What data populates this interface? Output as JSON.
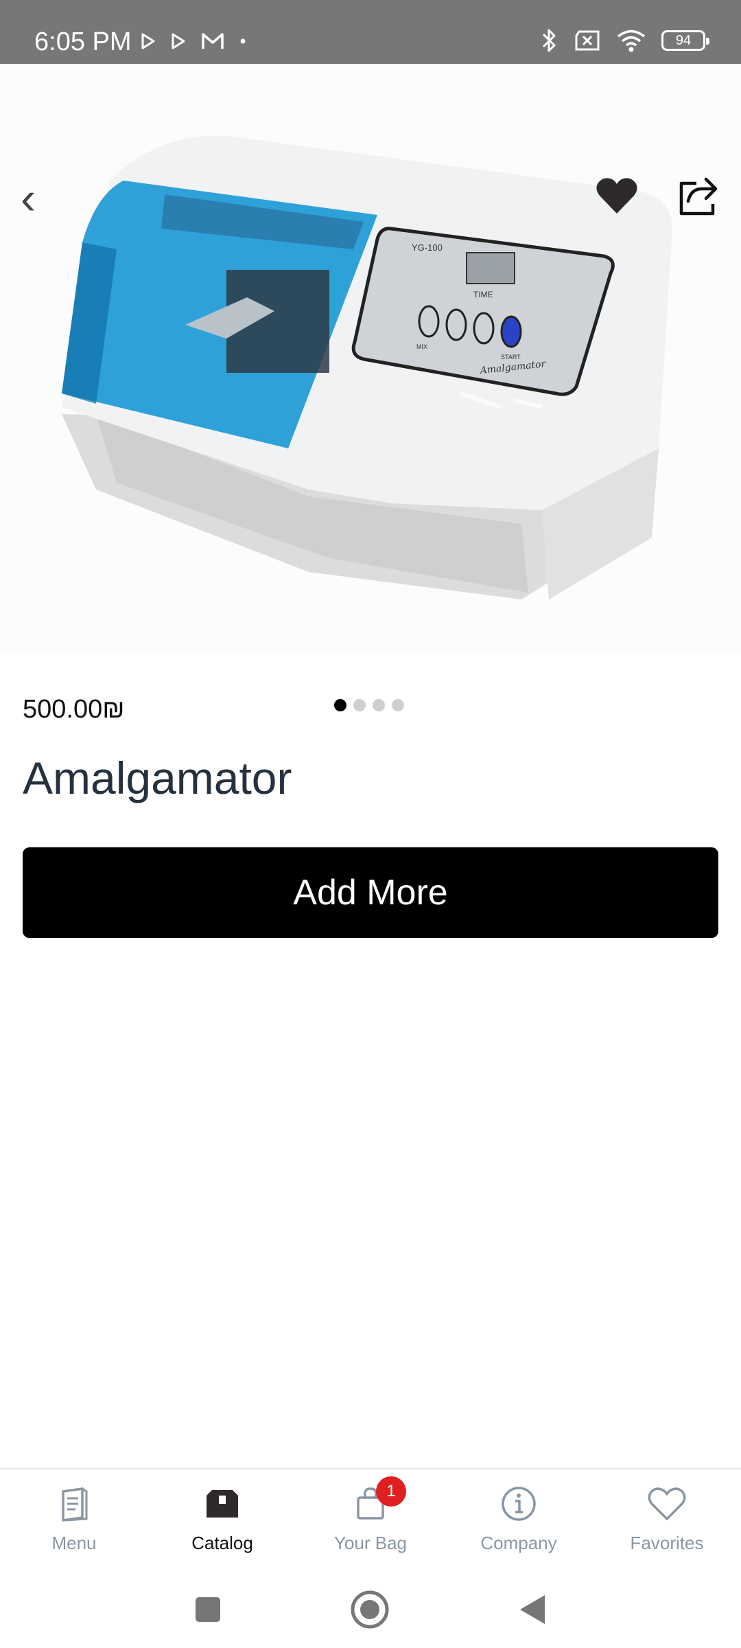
{
  "status_bar": {
    "time": "6:05 PM",
    "battery": "94",
    "icons": [
      "play-store-icon",
      "play-store-icon",
      "gmail-icon",
      "dot-icon",
      "bluetooth-icon",
      "no-sim-icon",
      "wifi-icon",
      "battery-icon"
    ]
  },
  "product": {
    "price": "500.00₪",
    "name": "Amalgamator",
    "image_count": 4,
    "active_image": 1,
    "image_labels": {
      "model": "YG-100",
      "time": "TIME",
      "mix": "MIX",
      "start": "START",
      "brand": "Amalgamator"
    }
  },
  "actions": {
    "add_more_label": "Add More"
  },
  "bottom_nav": {
    "items": [
      {
        "label": "Menu",
        "icon": "menu-book-icon"
      },
      {
        "label": "Catalog",
        "icon": "catalog-box-icon"
      },
      {
        "label": "Your Bag",
        "icon": "shopping-bag-icon",
        "badge": "1"
      },
      {
        "label": "Company",
        "icon": "info-icon"
      },
      {
        "label": "Favorites",
        "icon": "heart-outline-icon"
      }
    ],
    "active": "Catalog"
  },
  "colors": {
    "status_bar": "#777777",
    "button_bg": "#000000",
    "badge": "#e02020",
    "nav_inactive": "#8a96a3",
    "machine_lid": "#1e9ad6"
  }
}
